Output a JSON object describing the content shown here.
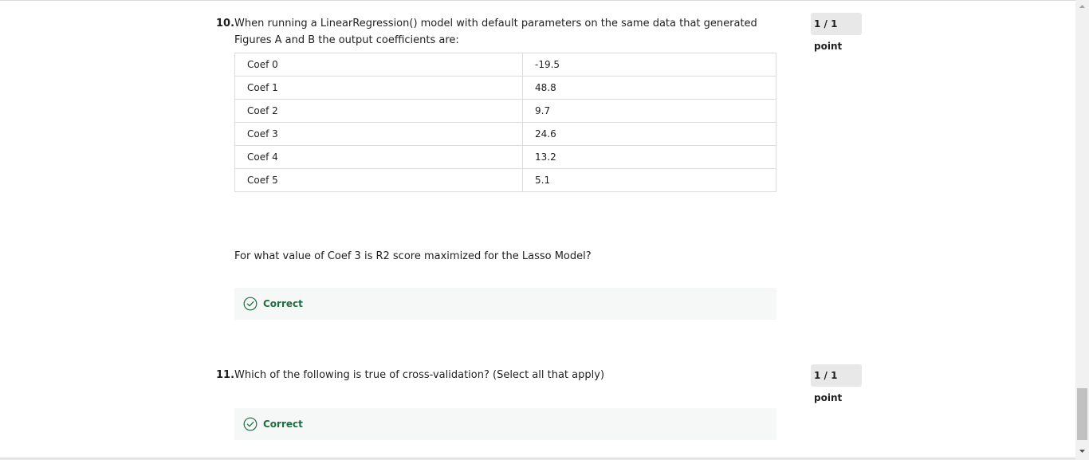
{
  "questions": [
    {
      "number": "10.",
      "text": "When running a LinearRegression() model with default parameters on the same data that generated Figures A and B the output coefficients are:",
      "score": "1 / 1 point",
      "table": [
        {
          "name": "Coef 0",
          "value": "-19.5"
        },
        {
          "name": "Coef 1",
          "value": "48.8"
        },
        {
          "name": "Coef 2",
          "value": "9.7"
        },
        {
          "name": "Coef 3",
          "value": "24.6"
        },
        {
          "name": "Coef 4",
          "value": "13.2"
        },
        {
          "name": "Coef 5",
          "value": "5.1"
        }
      ],
      "sub_question": "For what value of Coef 3 is R2 score maximized for the Lasso Model?",
      "feedback": "Correct"
    },
    {
      "number": "11.",
      "text": "Which of the following is true of cross-validation? (Select all that apply)",
      "score": "1 / 1 point",
      "feedback": "Correct"
    }
  ],
  "colors": {
    "correct": "#1f6e43",
    "feedback_bg": "#f5f8f6",
    "badge_bg": "#e8e8e8"
  },
  "icons": {
    "feedback": "check-circle-icon",
    "scroll_up": "triangle-up-icon",
    "scroll_down": "triangle-down-icon"
  }
}
